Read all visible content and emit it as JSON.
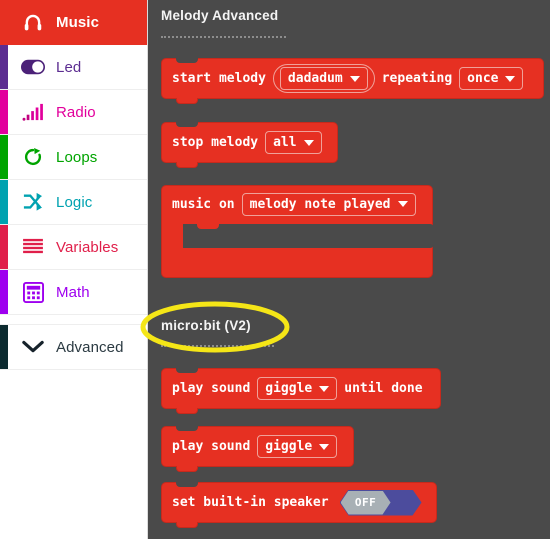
{
  "sidebar": {
    "categories": [
      {
        "label": "Music",
        "icon": "headphones-icon",
        "color": "#e63022",
        "selected": true
      },
      {
        "label": "Led",
        "icon": "toggle-icon",
        "color": "#5c2d91",
        "selected": false
      },
      {
        "label": "Radio",
        "icon": "signal-bars-icon",
        "color": "#e2009c",
        "selected": false
      },
      {
        "label": "Loops",
        "icon": "loop-arrow-icon",
        "color": "#00a400",
        "selected": false
      },
      {
        "label": "Logic",
        "icon": "shuffle-icon",
        "color": "#00a2b0",
        "selected": false
      },
      {
        "label": "Variables",
        "icon": "lines-icon",
        "color": "#e01f4a",
        "selected": false
      },
      {
        "label": "Math",
        "icon": "calculator-icon",
        "color": "#9e00ef",
        "selected": false
      }
    ],
    "advanced": {
      "label": "Advanced",
      "icon": "chevron-down-icon",
      "color": "#0b2a2f"
    }
  },
  "flyout": {
    "groups": [
      {
        "label": "Melody Advanced"
      },
      {
        "label": "micro:bit (V2)"
      }
    ],
    "blocks": {
      "start_melody": {
        "text1": "start melody",
        "melody": "dadadum",
        "text2": "repeating",
        "repeat": "once"
      },
      "stop_melody": {
        "text1": "stop melody",
        "target": "all"
      },
      "music_on": {
        "text1": "music on",
        "event": "melody note played"
      },
      "play_sound_until_done": {
        "text1": "play sound",
        "sound": "giggle",
        "text2": "until done"
      },
      "play_sound": {
        "text1": "play sound",
        "sound": "giggle"
      },
      "set_speaker": {
        "text1": "set built-in speaker",
        "state": "OFF"
      }
    }
  },
  "annotation": {
    "shape": "yellow-ellipse",
    "color": "#f5e617",
    "targets": "micro:bit (V2)"
  }
}
